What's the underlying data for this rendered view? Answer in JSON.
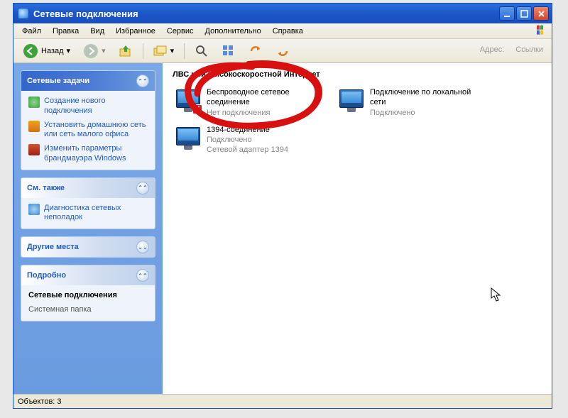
{
  "title": "Сетевые подключения",
  "menu": {
    "items": [
      "Файл",
      "Правка",
      "Вид",
      "Избранное",
      "Сервис",
      "Дополнительно",
      "Справка"
    ]
  },
  "toolbar": {
    "back_label": "Назад",
    "address_label": "Адрес:",
    "links_label": "Ссылки"
  },
  "sidebar": {
    "tasks": {
      "header": "Сетевые задачи",
      "items": [
        "Создание нового подключения",
        "Установить домашнюю сеть или сеть малого офиса",
        "Изменить параметры брандмауэра Windows"
      ]
    },
    "seealso": {
      "header": "См. также",
      "items": [
        "Диагностика сетевых неполадок"
      ]
    },
    "otherplaces": {
      "header": "Другие места"
    },
    "details": {
      "header": "Подробно",
      "name": "Сетевые подключения",
      "type": "Системная папка"
    }
  },
  "content": {
    "group_header": "ЛВС или высокоскоростной Интернет",
    "connections": [
      {
        "name": "Беспроводное сетевое соединение",
        "status": "Нет подключения",
        "has_error": true
      },
      {
        "name": "Подключение по локальной сети",
        "status": "Подключено",
        "has_error": false
      },
      {
        "name": "1394-соединение",
        "status": "Подключено",
        "status2": "Сетевой адаптер 1394",
        "has_error": false
      }
    ]
  },
  "statusbar": {
    "text": "Объектов: 3"
  }
}
